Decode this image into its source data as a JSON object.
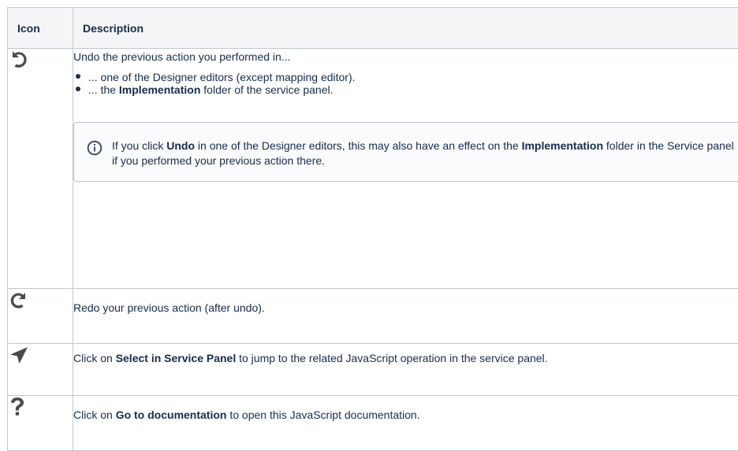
{
  "table": {
    "headers": {
      "icon": "Icon",
      "description": "Description"
    },
    "rows": [
      {
        "icon": "undo-icon",
        "intro": "Undo the previous action you performed in...",
        "bullets": [
          {
            "text": "... one of the Designer editors (except mapping editor)."
          },
          {
            "pre": "... the ",
            "bold": "Implementation",
            "post": " folder of the service panel."
          }
        ],
        "info": {
          "icon": "info-icon",
          "t1": "If you click ",
          "b1": "Undo",
          "t2": " in one of the Designer editors, this may also have an effect on the ",
          "b2": "Implementation",
          "t3": " folder in the Service panel if you performed your previous action there."
        }
      },
      {
        "icon": "redo-icon",
        "text": "Redo your previous action (after undo)."
      },
      {
        "icon": "navigate-arrow-icon",
        "pre": "Click on ",
        "bold": "Select in Service Panel",
        "post": " to jump to the related JavaScript operation in the service panel."
      },
      {
        "icon": "question-mark-icon",
        "pre": "Click on ",
        "bold": "Go to documentation",
        "post": " to open this JavaScript documentation."
      }
    ]
  },
  "colors": {
    "icon": "#4a4a4a",
    "info_icon": "#42526e",
    "border": "#c1c7d0",
    "header_bg": "#f4f5f7"
  }
}
